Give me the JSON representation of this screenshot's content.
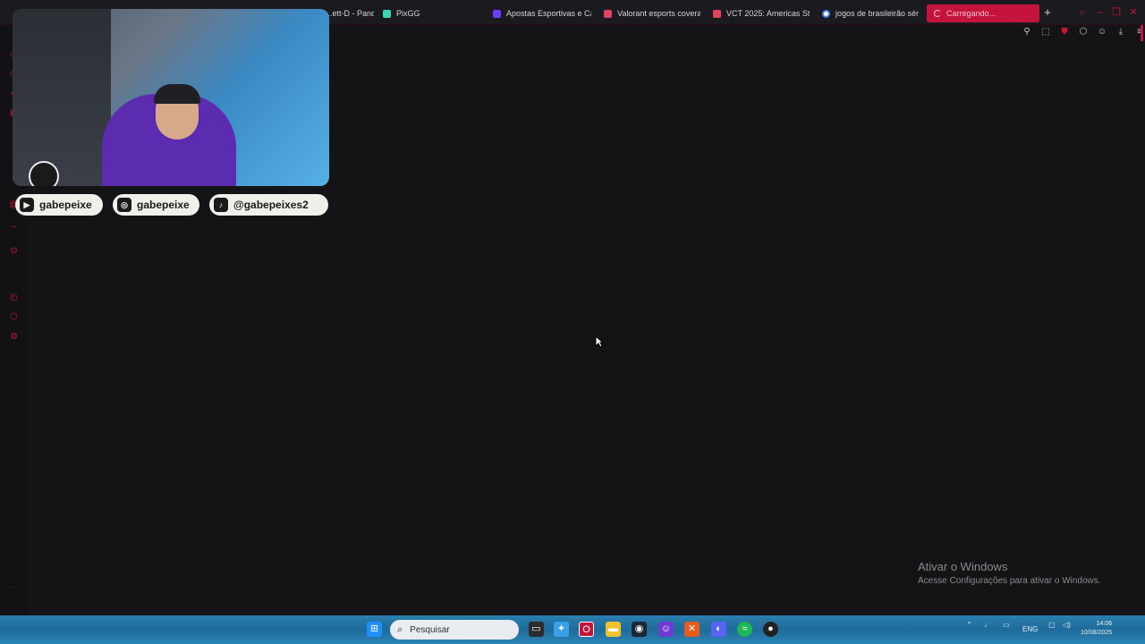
{
  "browser": {
    "tabs": [
      {
        "label": "...ett-D - Pand",
        "icon": "pandascore-icon",
        "color": "#c4143b"
      },
      {
        "label": "PixGG",
        "icon": "pixgg-icon",
        "color": "#3dd6b5"
      },
      {
        "label": "Apostas Esportivas e Ca",
        "icon": "betting-icon",
        "color": "#6a3cff"
      },
      {
        "label": "Valorant esports covera",
        "icon": "valorant-icon",
        "color": "#e0435b"
      },
      {
        "label": "VCT 2025: Americas St",
        "icon": "valorant-icon",
        "color": "#e0435b"
      },
      {
        "label": "jogos de brasileirão sér",
        "icon": "google-icon",
        "color": "#4285f4"
      },
      {
        "label": "Carregando...",
        "icon": "loading-spinner-icon",
        "color": "#c4143b"
      }
    ],
    "new_tab": "+",
    "window_controls": [
      "search-icon",
      "minimize-icon",
      "restore-icon",
      "close-icon"
    ],
    "toolbar_icons": [
      "pin-icon",
      "snapshot-icon",
      "shield-icon",
      "extensions-icon",
      "account-icon",
      "download-icon",
      "menu-icon"
    ]
  },
  "sidebar": {
    "icons": [
      "history-icon",
      "whatsapp-icon",
      "messenger-icon",
      "player-icon",
      "music-icon",
      "twitch-icon",
      "add-icon",
      "record-icon",
      "clock-icon",
      "extensions-icon",
      "settings-icon",
      "more-icon"
    ]
  },
  "overlay": {
    "socials": [
      {
        "platform": "youtube-icon",
        "handle": "gabepeixe"
      },
      {
        "platform": "instagram-icon",
        "handle": "gabepeixe"
      },
      {
        "platform": "tiktok-icon",
        "handle": "@gabepeixes2"
      }
    ]
  },
  "watermark": {
    "title": "Ativar o Windows",
    "subtitle": "Acesse Configurações para ativar o Windows."
  },
  "taskbar": {
    "search_placeholder": "Pesquisar",
    "apps": [
      "windows-start-icon",
      "task-view-icon",
      "copilot-icon",
      "opera-gx-icon",
      "file-explorer-icon",
      "steam-icon",
      "game-app-icon",
      "xbox-icon",
      "discord-icon",
      "spotify-icon",
      "obs-icon"
    ],
    "tray": {
      "language": "ENG"
    },
    "clock": {
      "time": "14:06",
      "date": "10/08/2025"
    }
  }
}
